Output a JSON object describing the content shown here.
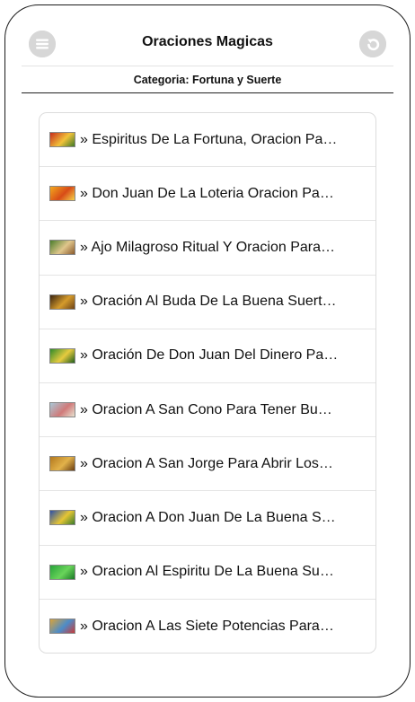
{
  "header": {
    "title": "Oraciones Magicas",
    "menu_icon": "menu-icon",
    "back_icon": "back-icon"
  },
  "subheader": {
    "label": "Categoria: Fortuna y Suerte"
  },
  "colors": {
    "header_button": "#d7d7d7",
    "divider": "#222222"
  },
  "items": [
    {
      "label": "» Espiritus De La Fortuna, Oracion Pa…",
      "thumb_colors": [
        "#c62d1c",
        "#f2c23a",
        "#3f7a27"
      ]
    },
    {
      "label": "» Don Juan De La Loteria Oracion Pa…",
      "thumb_colors": [
        "#f3a81e",
        "#d84b17",
        "#f5d24a"
      ]
    },
    {
      "label": "» Ajo Milagroso Ritual Y Oracion Para…",
      "thumb_colors": [
        "#4a7d2b",
        "#e0c68c",
        "#8a5a2c"
      ]
    },
    {
      "label": "» Oración Al Buda De La Buena Suert…",
      "thumb_colors": [
        "#3a2410",
        "#d59b2b",
        "#6d4317"
      ]
    },
    {
      "label": "» Oración De Don Juan Del Dinero Pa…",
      "thumb_colors": [
        "#2f8a2a",
        "#e7cb3f",
        "#1f5e1c"
      ]
    },
    {
      "label": "» Oracion A San Cono Para Tener Bu…",
      "thumb_colors": [
        "#a9c7d6",
        "#d07a7a",
        "#e8e2d0"
      ]
    },
    {
      "label": "» Oracion A San Jorge Para Abrir Los…",
      "thumb_colors": [
        "#b3781e",
        "#e2b24a",
        "#6b3e12"
      ]
    },
    {
      "label": "» Oracion A Don Juan De La Buena S…",
      "thumb_colors": [
        "#2b4fa8",
        "#e6c534",
        "#3a7d2c"
      ]
    },
    {
      "label": "» Oracion Al Espiritu De La Buena Su…",
      "thumb_colors": [
        "#27a33a",
        "#69d45a",
        "#1b7a27"
      ]
    },
    {
      "label": "» Oracion A Las Siete Potencias Para…",
      "thumb_colors": [
        "#d9a33a",
        "#4c8cc9",
        "#c83a3a"
      ]
    }
  ]
}
